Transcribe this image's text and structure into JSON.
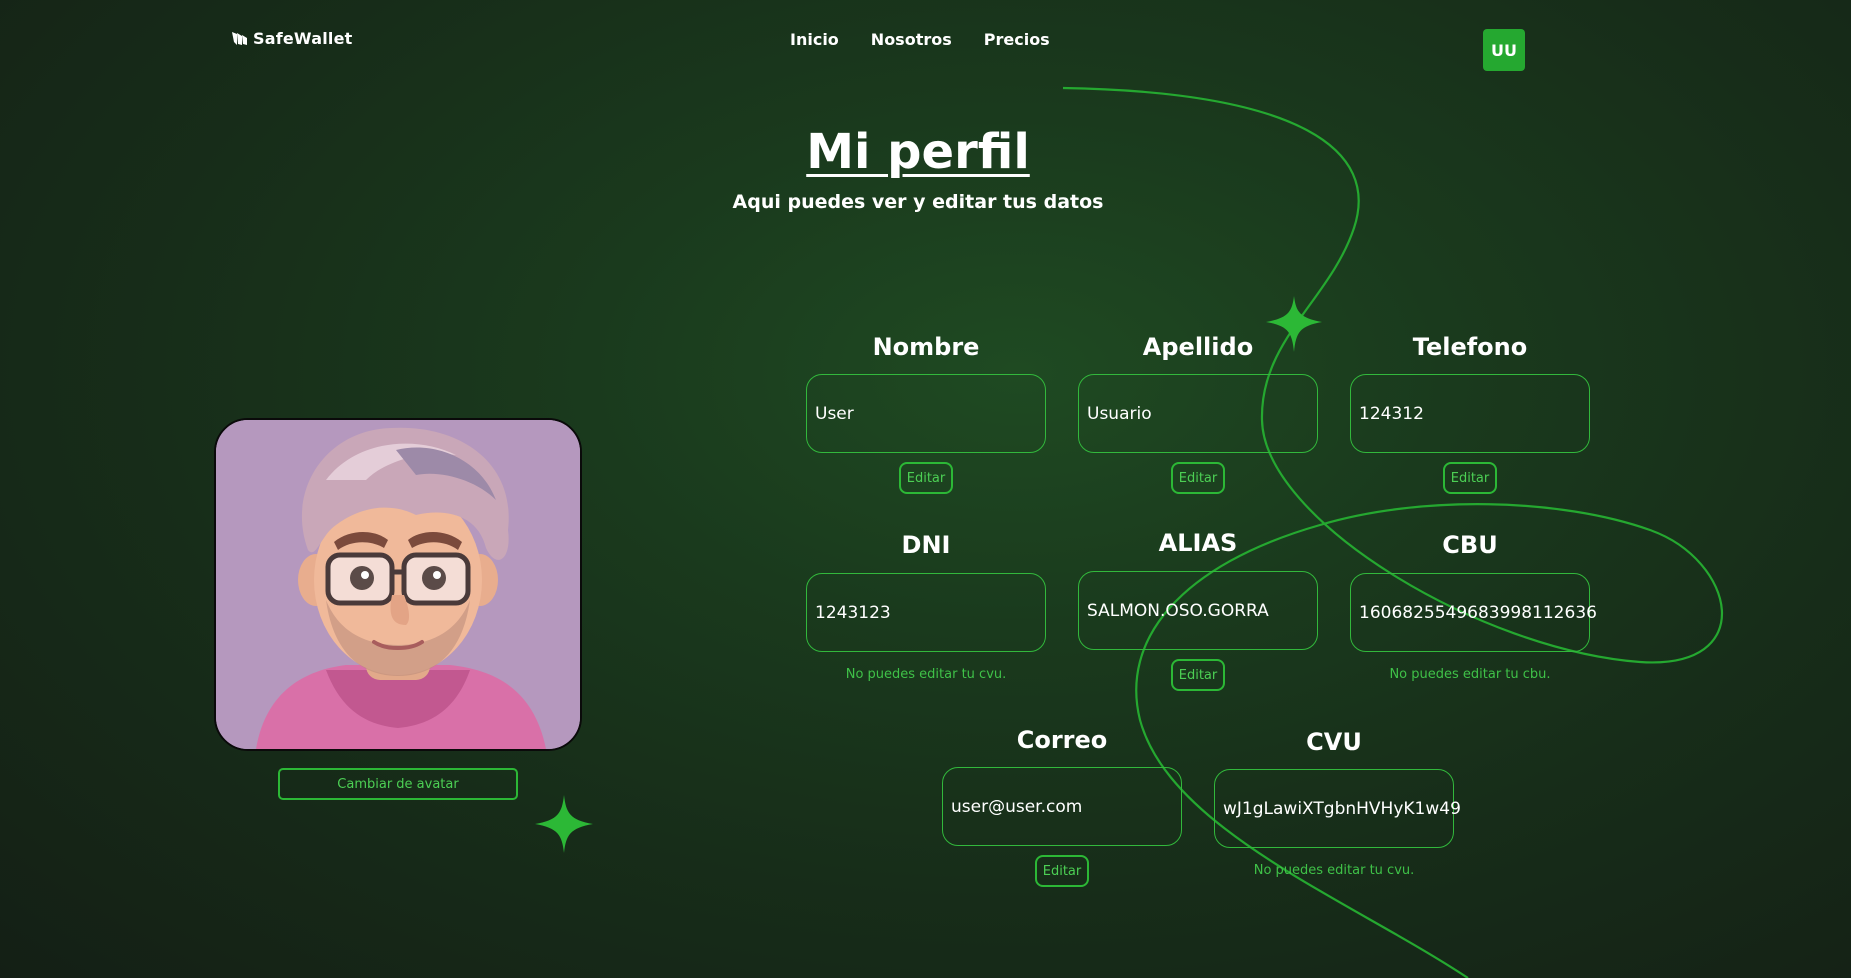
{
  "header": {
    "brand": "SafeWallet",
    "nav": [
      "Inicio",
      "Nosotros",
      "Precios"
    ],
    "user_initials": "UU"
  },
  "page": {
    "title": "Mi perfil",
    "subtitle": "Aqui puedes ver y editar tus datos"
  },
  "avatar": {
    "change_button": "Cambiar de avatar"
  },
  "fields": {
    "nombre": {
      "label": "Nombre",
      "value": "User",
      "action": "Editar"
    },
    "apellido": {
      "label": "Apellido",
      "value": "Usuario",
      "action": "Editar"
    },
    "telefono": {
      "label": "Telefono",
      "value": "124312",
      "action": "Editar"
    },
    "dni": {
      "label": "DNI",
      "value": "1243123",
      "note": "No puedes editar tu cvu."
    },
    "alias": {
      "label": "ALIAS",
      "value": "SALMON.OSO.GORRA",
      "action": "Editar"
    },
    "cbu": {
      "label": "CBU",
      "value": "1606825549683998112636",
      "note": "No puedes editar tu cbu."
    },
    "correo": {
      "label": "Correo",
      "value": "user@user.com",
      "action": "Editar"
    },
    "cvu": {
      "label": "CVU",
      "value": "wJ1gLawiXTgbnHVHyK1w49",
      "note": "No puedes editar tu cvu."
    }
  },
  "colors": {
    "accent": "#25a830",
    "accent_text": "#4ccf54",
    "background": "#172d19"
  },
  "icons": {
    "brand": "wing-logo-icon",
    "decor": [
      "sparkle-star-icon",
      "sparkle-star-icon"
    ]
  }
}
